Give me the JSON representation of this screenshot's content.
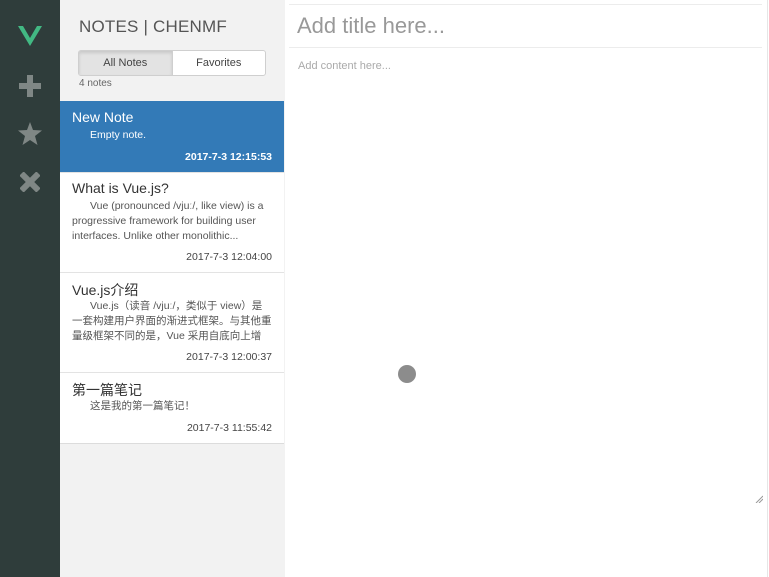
{
  "colors": {
    "toolbar_bg": "#2f3d3b",
    "vue_logo": "#42b983",
    "icon_gray": "#7f8785",
    "selected_note_bg": "#337ab7",
    "panel_bg": "#f2f2f2"
  },
  "toolbar": {
    "icons": [
      "vue-logo",
      "plus-icon",
      "star-icon",
      "close-icon"
    ]
  },
  "panel": {
    "title": "NOTES | CHENMF",
    "toggle": {
      "all_label": "All Notes",
      "favorites_label": "Favorites",
      "active": "All Notes"
    },
    "count": "4 notes"
  },
  "notes": [
    {
      "title": "New Note",
      "body": "Empty note.",
      "time": "2017-7-3 12:15:53",
      "selected": true
    },
    {
      "title": "What is Vue.js?",
      "body": "Vue (pronounced /vjuː/, like view) is a progressive framework for building user interfaces. Unlike other monolithic...",
      "time": "2017-7-3 12:04:00",
      "selected": false
    },
    {
      "title": "Vue.js介绍",
      "body": "Vue.js（读音 /vjuː/，类似于 view）是一套构建用户界面的渐进式框架。与其他重量级框架不同的是，Vue 采用自底向上增",
      "time": "2017-7-3 12:00:37",
      "selected": false
    },
    {
      "title": "第一篇笔记",
      "body": "这是我的第一篇笔记！",
      "time": "2017-7-3 11:55:42",
      "selected": false
    }
  ],
  "editor": {
    "title_placeholder": "Add title here...",
    "title_value": "",
    "content_placeholder": "Add content here...",
    "content_value": ""
  }
}
